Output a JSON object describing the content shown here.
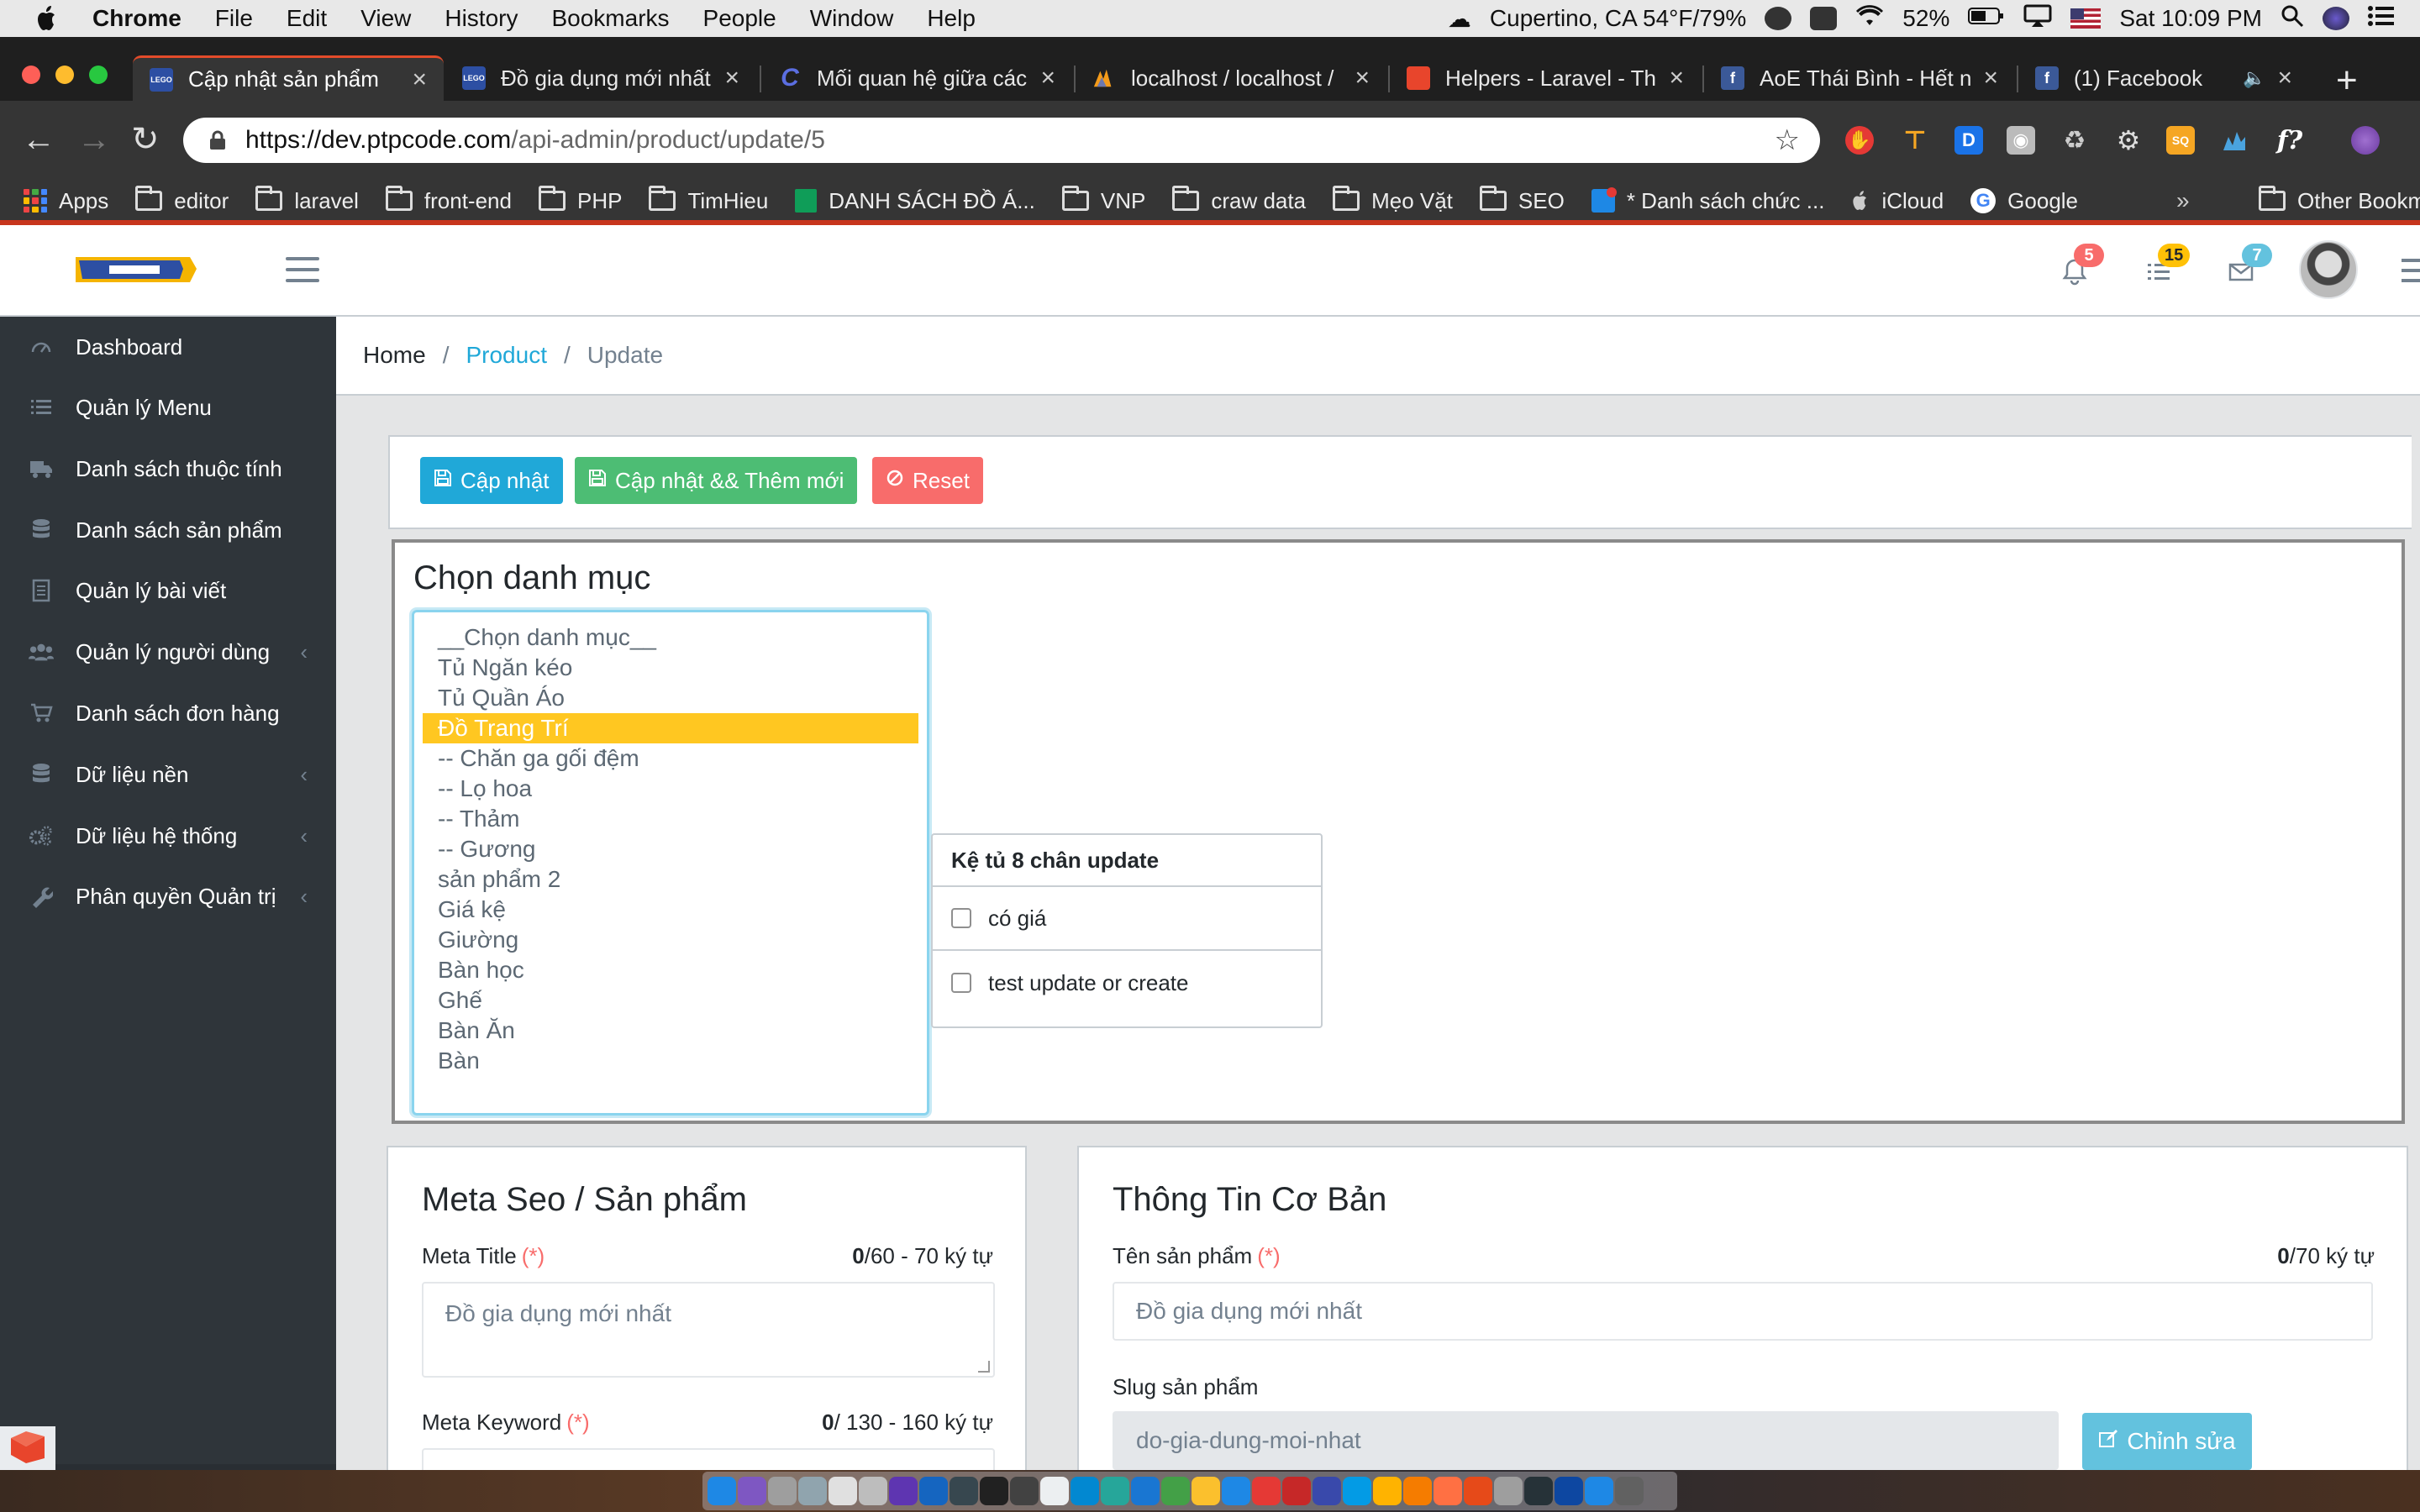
{
  "menubar": {
    "app_name": "Chrome",
    "menus": [
      "File",
      "Edit",
      "View",
      "History",
      "Bookmarks",
      "People",
      "Window",
      "Help"
    ],
    "weather": "Cupertino, CA 54°F/79%",
    "battery": "52%",
    "clock": "Sat 10:09 PM"
  },
  "tabs": [
    {
      "label": "Cập nhật sản phẩm",
      "favicon_color": "#2d4fa3",
      "favicon_text": "LEGO",
      "active": true
    },
    {
      "label": "Đồ gia dụng mới nhất",
      "favicon_color": "#2d4fa3",
      "favicon_text": "LEGO",
      "active": false
    },
    {
      "label": "Mối quan hệ giữa các",
      "favicon_color": "#1e2d7a",
      "favicon_text": "C",
      "active": false
    },
    {
      "label": "localhost / localhost /",
      "favicon_color": "#f49b1a",
      "favicon_text": "",
      "active": false
    },
    {
      "label": "Helpers - Laravel - Th",
      "favicon_color": "#e8452c",
      "favicon_text": "",
      "active": false
    },
    {
      "label": "AoE Thái Bình - Hết n",
      "favicon_color": "#3b5998",
      "favicon_text": "f",
      "active": false
    },
    {
      "label": "(1) Facebook",
      "favicon_color": "#3b5998",
      "favicon_text": "f",
      "active": false
    }
  ],
  "omnibox": {
    "url_host": "https://dev.ptpcode.com",
    "url_path": "/api-admin/product/update/5"
  },
  "bookmarks": {
    "apps": "Apps",
    "items": [
      {
        "label": "editor",
        "icon": "folder-icon"
      },
      {
        "label": "laravel",
        "icon": "folder-icon"
      },
      {
        "label": "front-end",
        "icon": "folder-icon"
      },
      {
        "label": "PHP",
        "icon": "folder-icon"
      },
      {
        "label": "TimHieu",
        "icon": "folder-icon"
      },
      {
        "label": "DANH SÁCH ĐỒ Á...",
        "icon": "sheets-icon"
      },
      {
        "label": "VNP",
        "icon": "folder-icon"
      },
      {
        "label": "craw data",
        "icon": "folder-icon"
      },
      {
        "label": "Mẹo Vặt",
        "icon": "folder-icon"
      },
      {
        "label": "SEO",
        "icon": "folder-icon"
      },
      {
        "label": "* Danh sách chức ...",
        "icon": "doc-icon"
      },
      {
        "label": "iCloud",
        "icon": "apple-icon"
      },
      {
        "label": "Google",
        "icon": "google-icon"
      }
    ],
    "more": "»",
    "other": "Other Bookmarks"
  },
  "header": {
    "notification_count": "5",
    "list_count": "15",
    "mail_count": "7",
    "colors": {
      "danger": "#f86c6b",
      "warning": "#ffc107",
      "info": "#63c2de"
    }
  },
  "sidebar": {
    "items": [
      {
        "label": "Dashboard",
        "icon": "speedometer-icon",
        "has_children": false
      },
      {
        "label": "Quản lý Menu",
        "icon": "list-icon",
        "has_children": false
      },
      {
        "label": "Danh sách thuộc tính",
        "icon": "truck-icon",
        "has_children": false
      },
      {
        "label": "Danh sách sản phẩm",
        "icon": "database-icon",
        "has_children": false
      },
      {
        "label": "Quản lý bài viết",
        "icon": "article-icon",
        "has_children": false
      },
      {
        "label": "Quản lý người dùng",
        "icon": "users-icon",
        "has_children": true
      },
      {
        "label": "Danh sách đơn hàng",
        "icon": "cart-icon",
        "has_children": false
      },
      {
        "label": "Dữ liệu nền",
        "icon": "database-icon",
        "has_children": true
      },
      {
        "label": "Dữ liệu hệ thống",
        "icon": "cogs-icon",
        "has_children": true
      },
      {
        "label": "Phân quyền Quản trị",
        "icon": "wrench-icon",
        "has_children": true
      }
    ],
    "collapse_label": "‹"
  },
  "breadcrumb": {
    "home": "Home",
    "product": "Product",
    "current": "Update",
    "sep": "/"
  },
  "actions": {
    "update": "Cập nhật",
    "update_and_new": "Cập nhật && Thêm mới",
    "reset": "Reset",
    "colors": {
      "primary": "#20a8d8",
      "success": "#4dbd74",
      "danger": "#f86c6b"
    }
  },
  "category": {
    "title": "Chọn danh mục",
    "options": [
      "__Chọn danh mục__",
      "Tủ Ngăn kéo",
      "Tủ Quần Áo",
      "Đồ Trang Trí",
      "-- Chăn ga gối đệm",
      "-- Lọ hoa",
      "-- Thảm",
      "-- Gương",
      "sản phẩm 2",
      "Giá kệ",
      "Giường",
      "Bàn học",
      "Ghế",
      "Bàn Ăn",
      "Bàn"
    ],
    "selected_index": 3,
    "attribute_group": {
      "title": "Kệ tủ 8 chân update",
      "options": [
        "có giá",
        "test update or create"
      ]
    }
  },
  "seo": {
    "title": "Meta Seo / Sản phẩm",
    "meta_title_label": "Meta Title",
    "meta_title_count": "0",
    "meta_title_limit": "/60 - 70 ký tự",
    "meta_title_placeholder": "Đồ gia dụng mới nhất",
    "meta_keyword_label": "Meta Keyword",
    "meta_keyword_count": "0",
    "meta_keyword_limit": "/ 130 - 160 ký tự",
    "required_mark": "(*)"
  },
  "basic_info": {
    "title": "Thông Tin Cơ Bản",
    "name_label": "Tên sản phẩm",
    "name_count": "0",
    "name_limit": "/70 ký tự",
    "name_placeholder": "Đồ gia dụng mới nhất",
    "slug_label": "Slug sản phẩm",
    "slug_value": "do-gia-dung-moi-nhat",
    "edit_button": "Chỉnh sửa"
  }
}
